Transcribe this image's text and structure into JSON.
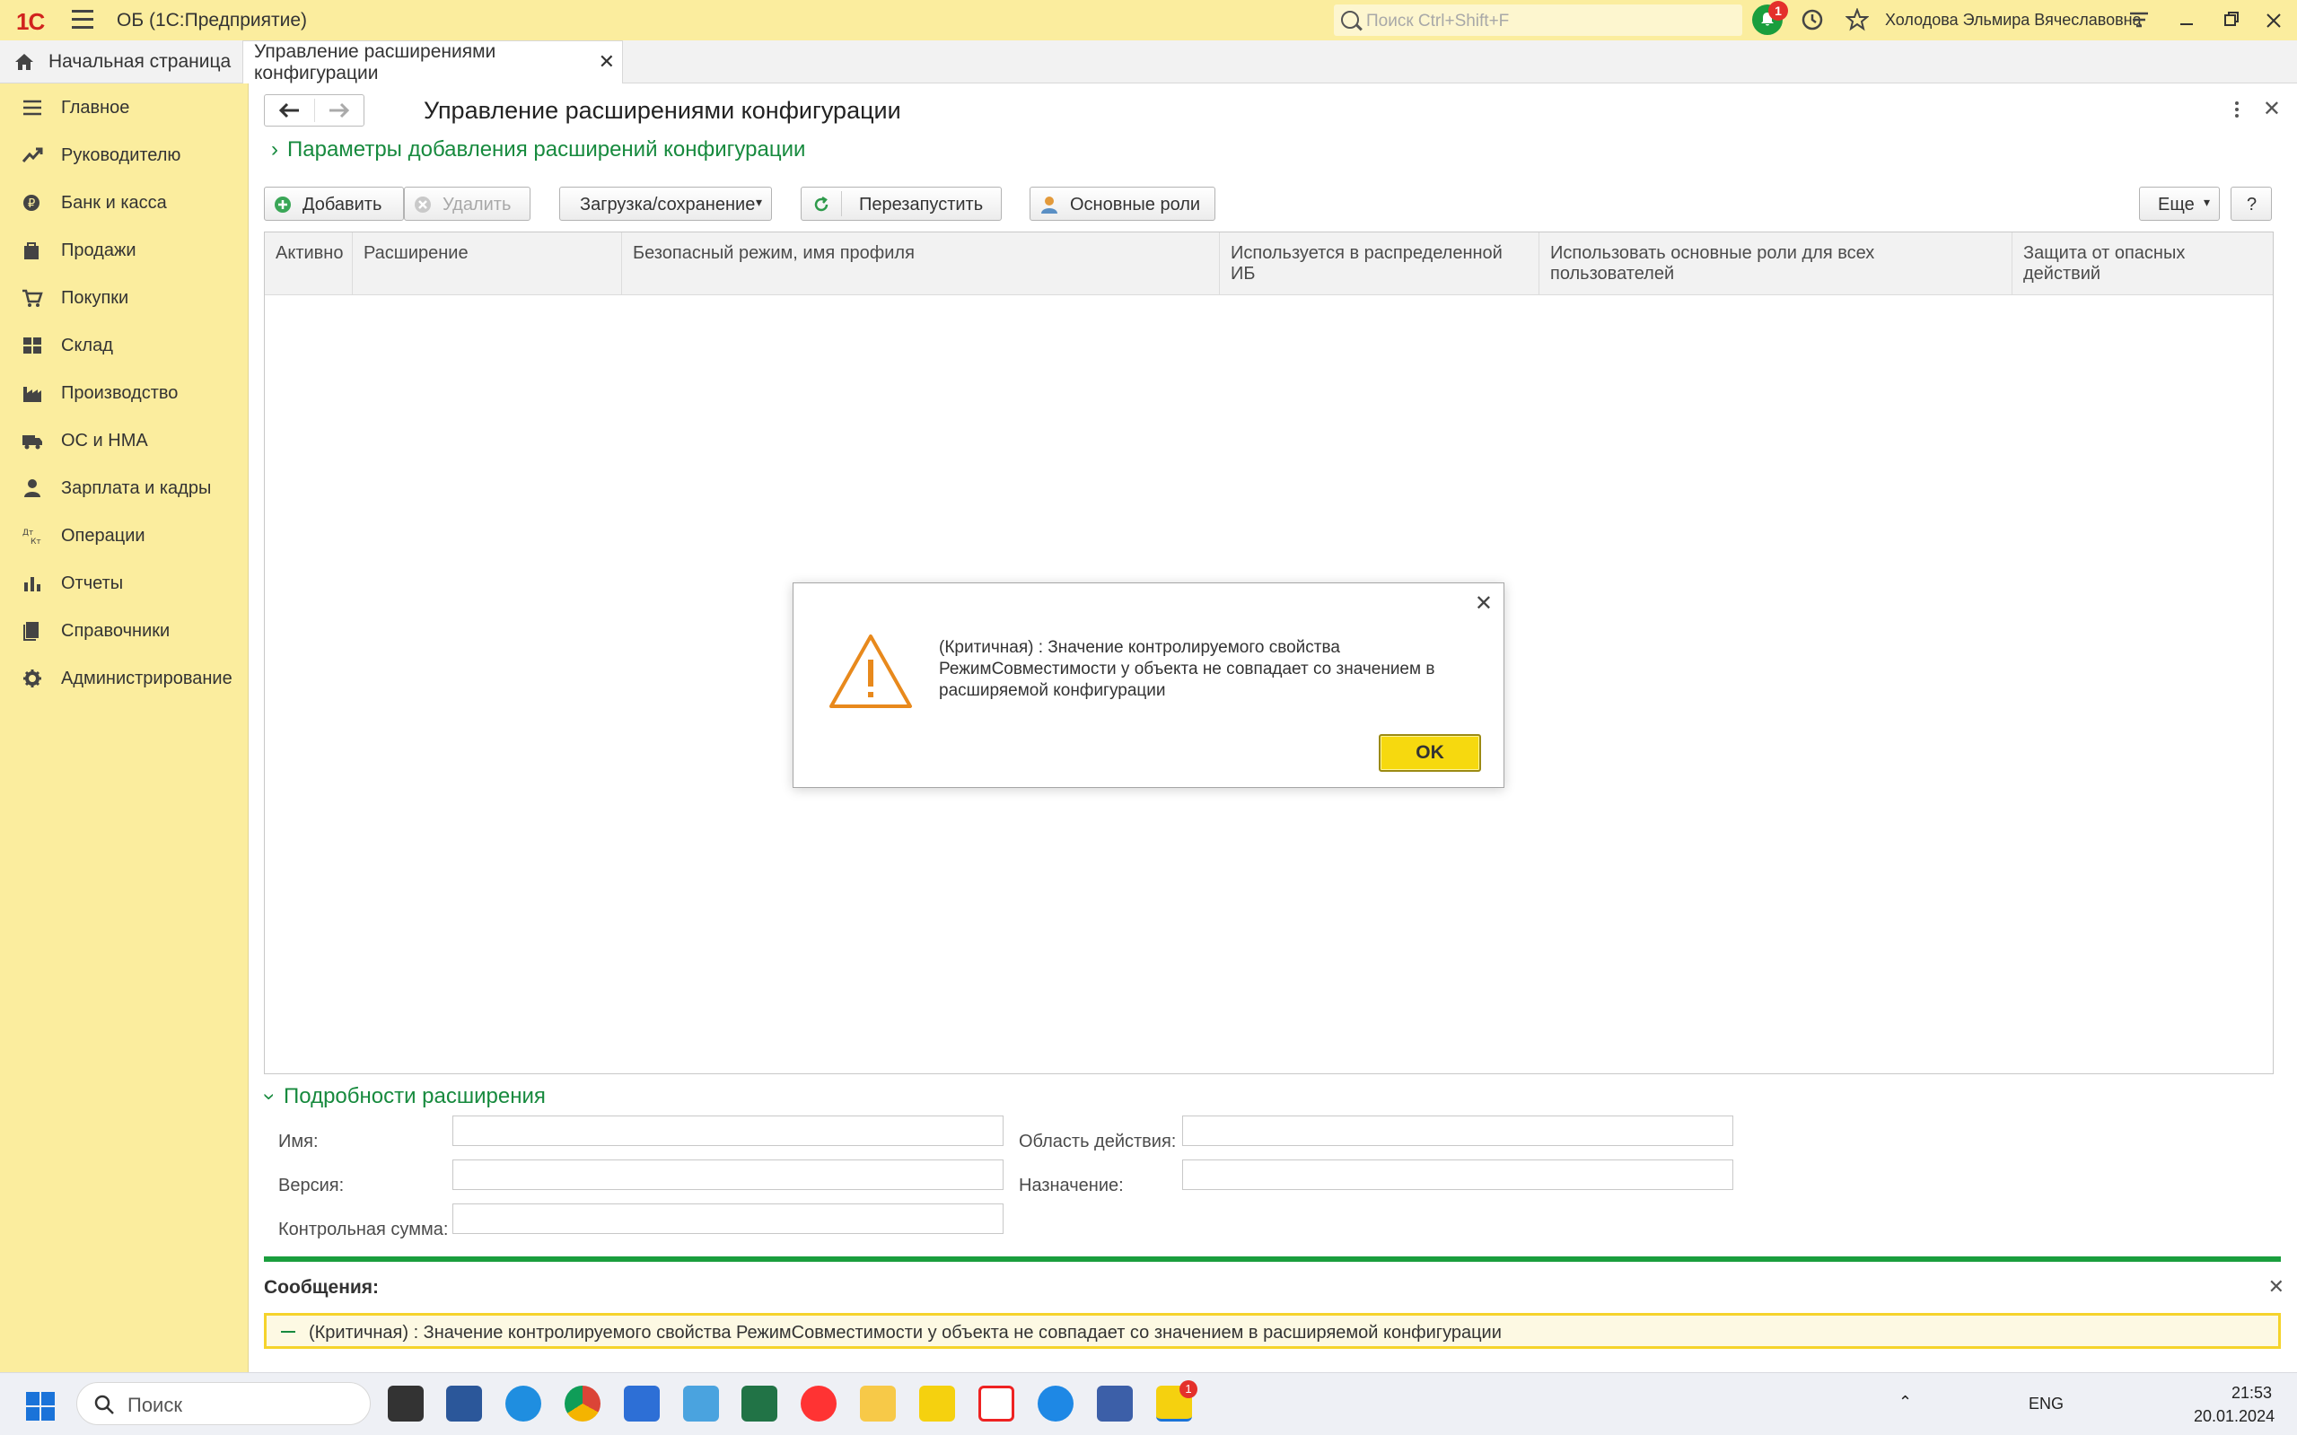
{
  "titlebar": {
    "logo": "1С",
    "title": "ОБ  (1С:Предприятие)",
    "search_placeholder": "Поиск Ctrl+Shift+F",
    "notifications_count": "1",
    "user": "Холодова Эльмира Вячеславовна"
  },
  "tabs": {
    "home": "Начальная страница",
    "active": "Управление расширениями конфигурации",
    "close": "✕"
  },
  "sidebar": {
    "items": [
      {
        "label": "Главное",
        "icon": "menu-icon"
      },
      {
        "label": "Руководителю",
        "icon": "trend-icon"
      },
      {
        "label": "Банк и касса",
        "icon": "coins-icon"
      },
      {
        "label": "Продажи",
        "icon": "bag-icon"
      },
      {
        "label": "Покупки",
        "icon": "cart-icon"
      },
      {
        "label": "Склад",
        "icon": "warehouse-icon"
      },
      {
        "label": "Производство",
        "icon": "factory-icon"
      },
      {
        "label": "ОС и НМА",
        "icon": "truck-icon"
      },
      {
        "label": "Зарплата и кадры",
        "icon": "person-icon"
      },
      {
        "label": "Операции",
        "icon": "dtkt-icon"
      },
      {
        "label": "Отчеты",
        "icon": "bar-chart-icon"
      },
      {
        "label": "Справочники",
        "icon": "books-icon"
      },
      {
        "label": "Администрирование",
        "icon": "gear-icon"
      }
    ]
  },
  "page": {
    "title": "Управление расширениями конфигурации",
    "params_group": "Параметры добавления расширений конфигурации"
  },
  "toolbar": {
    "add": "Добавить",
    "delete": "Удалить",
    "load_save": "Загрузка/сохранение",
    "restart": "Перезапустить",
    "main_roles": "Основные роли",
    "more": "Еще",
    "help": "?"
  },
  "table": {
    "columns": [
      "Активно",
      "Расширение",
      "Безопасный режим, имя профиля",
      "Используется в распределенной ИБ",
      "Использовать основные роли для всех пользователей",
      "Защита от опасных действий"
    ],
    "rows": []
  },
  "details": {
    "header": "Подробности расширения",
    "name_label": "Имя:",
    "name_value": "",
    "version_label": "Версия:",
    "version_value": "",
    "checksum_label": "Контрольная сумма:",
    "checksum_value": "",
    "scope_label": "Область действия:",
    "scope_value": "",
    "purpose_label": "Назначение:",
    "purpose_value": ""
  },
  "messages": {
    "title": "Сообщения:",
    "items": [
      "(Критичная) : Значение контролируемого свойства РежимСовместимости у объекта  не совпадает со значением в расширяемой конфигурации"
    ]
  },
  "dialog": {
    "text": "(Критичная) : Значение контролируемого свойства РежимСовместимости у объекта  не совпадает со значением в расширяемой конфигурации",
    "ok": "OK"
  },
  "taskbar": {
    "search": "Поиск",
    "lang": "ENG",
    "time": "21:53",
    "date": "20.01.2024",
    "badge_1c": "1"
  },
  "colors": {
    "accent_yellow": "#fbed9e",
    "accent_green": "#178a3e",
    "ok_button": "#f6d90f",
    "warning_orange": "#e8891c"
  }
}
